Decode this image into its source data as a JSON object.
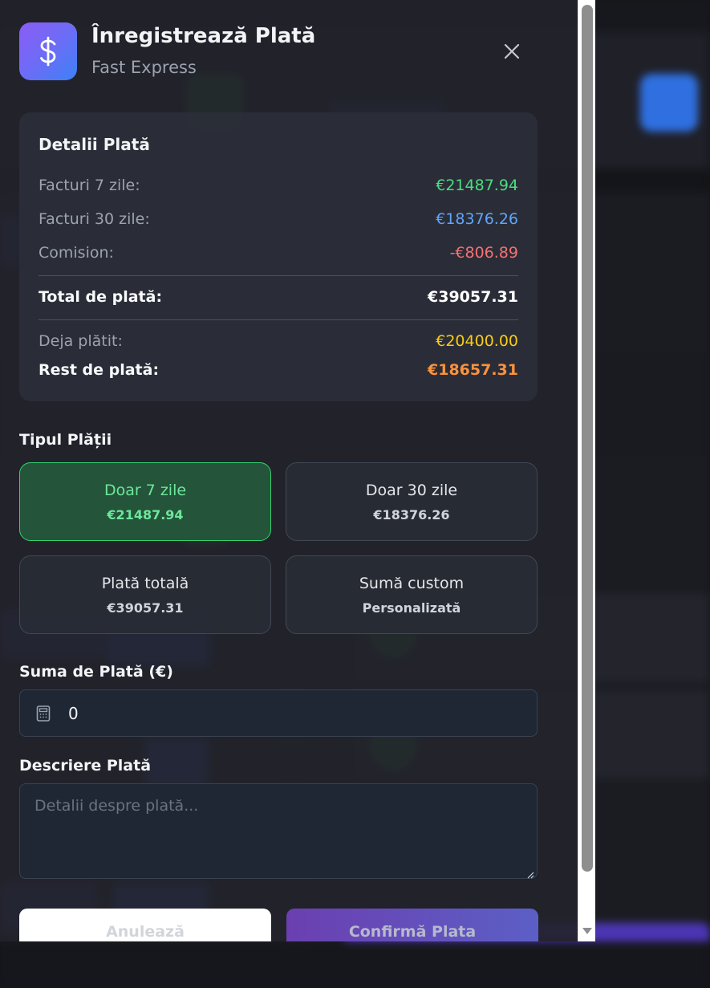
{
  "modal": {
    "title": "Înregistrează Plată",
    "subtitle": "Fast Express",
    "logo_icon": "dollar-icon",
    "close_icon": "close-icon"
  },
  "details": {
    "title": "Detalii Plată",
    "rows": [
      {
        "label": "Facturi 7 zile:",
        "value": "€21487.94",
        "color": "#4ade80"
      },
      {
        "label": "Facturi 30 zile:",
        "value": "€18376.26",
        "color": "#60a5fa"
      },
      {
        "label": "Comision:",
        "value": "-€806.89",
        "color": "#f87171"
      }
    ],
    "total": {
      "label": "Total de plată:",
      "value": "€39057.31",
      "color": "#ffffff"
    },
    "paid": {
      "label": "Deja plătit:",
      "value": "€20400.00",
      "color": "#facc15"
    },
    "rest": {
      "label": "Rest de plată:",
      "value": "€18657.31",
      "color": "#fb923c"
    }
  },
  "payment_type": {
    "label": "Tipul Plății",
    "options": [
      {
        "title": "Doar 7 zile",
        "sub": "€21487.94",
        "active": true
      },
      {
        "title": "Doar 30 zile",
        "sub": "€18376.26",
        "active": false
      },
      {
        "title": "Plată totală",
        "sub": "€39057.31",
        "active": false
      },
      {
        "title": "Sumă custom",
        "sub": "Personalizată",
        "active": false
      }
    ]
  },
  "amount": {
    "label": "Suma de Plată (€)",
    "value": "0",
    "icon": "calculator-icon"
  },
  "description": {
    "label": "Descriere Plată",
    "placeholder": "Detalii despre plată..."
  },
  "buttons": {
    "cancel": "Anulează",
    "confirm": "Confirmă Plata"
  },
  "colors": {
    "accent_green": "#34d36f",
    "logo_gradient_start": "#8b5cf6",
    "logo_gradient_end": "#3b82f6"
  }
}
